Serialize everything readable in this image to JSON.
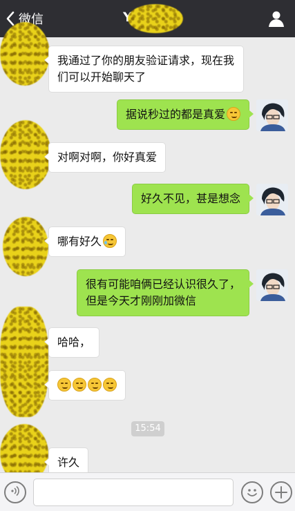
{
  "header": {
    "back_label": "微信",
    "title": "Y"
  },
  "messages": [
    {
      "side": "in",
      "text": "我通过了你的朋友验证请求，现在我们可以开始聊天了"
    },
    {
      "side": "out",
      "text": "据说秒过的都是真爱",
      "emoji": "smirk-emoji"
    },
    {
      "side": "in",
      "text": "对啊对啊，你好真爱"
    },
    {
      "side": "out",
      "text": "好久不见，甚是想念"
    },
    {
      "side": "in",
      "text": "哪有好久",
      "emoji": "laugh-cry-emoji"
    },
    {
      "side": "out",
      "text": "很有可能咱俩已经认识很久了，但是今天才刚刚加微信"
    },
    {
      "side": "in",
      "text": "哈哈，"
    },
    {
      "side": "in",
      "emoji_count": 4,
      "emoji": "smirk-emoji"
    },
    {
      "side": "in",
      "text": "许久"
    }
  ],
  "timestamp": "15:54",
  "input": {
    "placeholder": ""
  },
  "colors": {
    "header_bg": "#2e2e33",
    "chat_bg": "#ebebeb",
    "out_bubble": "#9ee34f",
    "in_bubble": "#ffffff"
  }
}
